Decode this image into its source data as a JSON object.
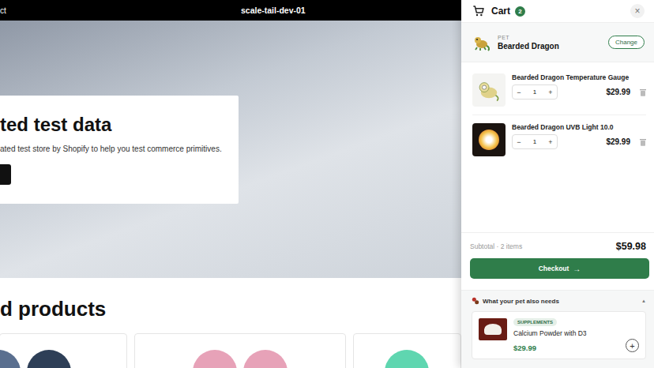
{
  "store": {
    "nav_link": "ct",
    "title": "scale-tail-dev-01"
  },
  "hero": {
    "heading": "ted test data",
    "text": "ated test store by Shopify to help you test commerce primitives."
  },
  "featured": {
    "heading": "d products"
  },
  "cart": {
    "title": "Cart",
    "count": "2",
    "close": "×",
    "pet": {
      "label": "PET",
      "name": "Bearded Dragon",
      "change": "Change"
    },
    "items": [
      {
        "name": "Bearded Dragon Temperature Gauge",
        "minus": "−",
        "qty": "1",
        "plus": "+",
        "price": "$29.99",
        "kind": "gauge"
      },
      {
        "name": "Bearded Dragon UVB Light 10.0",
        "minus": "−",
        "qty": "1",
        "plus": "+",
        "price": "$29.99",
        "kind": "lamp"
      }
    ],
    "subtotal_label": "Subtotal · 2 items",
    "subtotal": "$59.98",
    "checkout": "Checkout",
    "checkout_arrow": "→",
    "recommendations": {
      "title": "What your pet also needs",
      "toggle": "▲",
      "expanded": true,
      "items": [
        {
          "tag": "SUPPLEMENTS",
          "name": "Calcium Powder with D3",
          "price": "$29.99",
          "add": "+"
        }
      ]
    }
  }
}
